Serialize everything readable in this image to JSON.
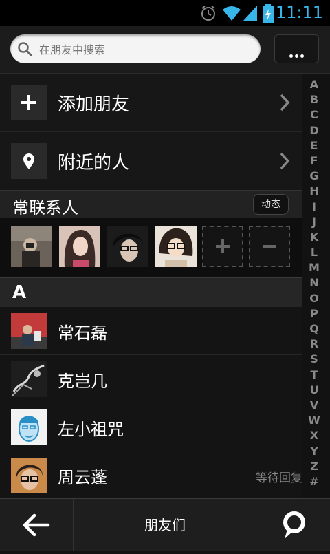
{
  "status_bar": {
    "time": "11:11"
  },
  "search": {
    "placeholder": "在朋友中搜索"
  },
  "actions": {
    "add_friend": "添加朋友",
    "nearby": "附近的人"
  },
  "frequent": {
    "title": "常联系人",
    "feed_button": "动态",
    "add": "+",
    "remove": "−"
  },
  "list": {
    "letter": "A",
    "contacts": [
      {
        "name": "常石磊",
        "status": ""
      },
      {
        "name": "克岂几",
        "status": ""
      },
      {
        "name": "左小祖咒",
        "status": ""
      },
      {
        "name": "周云蓬",
        "status": "等待回复"
      }
    ]
  },
  "index": [
    "A",
    "B",
    "C",
    "D",
    "E",
    "F",
    "G",
    "H",
    "I",
    "J",
    "K",
    "L",
    "M",
    "N",
    "O",
    "P",
    "Q",
    "R",
    "S",
    "T",
    "U",
    "V",
    "W",
    "X",
    "Y",
    "Z",
    "#"
  ],
  "bottom_bar": {
    "title": "朋友们"
  },
  "colors": {
    "accent": "#38b6ea",
    "background": "#121212"
  }
}
